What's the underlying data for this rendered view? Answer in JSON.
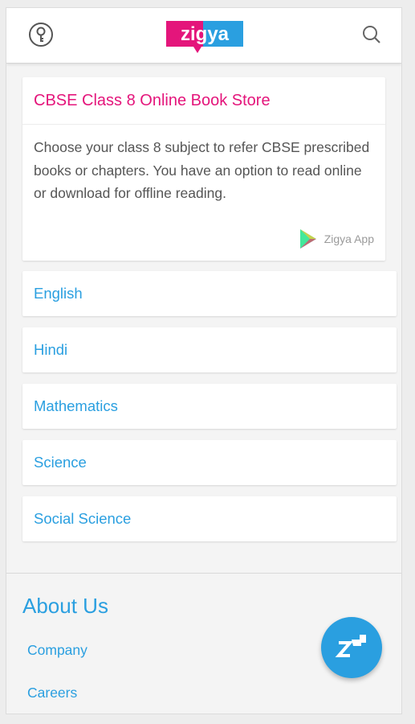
{
  "header": {
    "logo_text": "zigya",
    "icons": [
      "key-icon",
      "search-icon"
    ]
  },
  "intro": {
    "title": "CBSE Class 8 Online Book Store",
    "description": "Choose your class 8 subject to refer CBSE prescribed books or chapters. You have an option to read online or download for offline reading.",
    "app_label": "Zigya App",
    "app_icon": "google-play-icon"
  },
  "subjects": [
    "English",
    "Hindi",
    "Mathematics",
    "Science",
    "Social Science"
  ],
  "footer": {
    "about_title": "About Us",
    "links": [
      "Company",
      "Careers"
    ]
  },
  "fab_icon": "zigya-share-icon",
  "colors": {
    "brand_pink": "#e4157b",
    "brand_blue": "#2a9fe0",
    "text_gray": "#555555",
    "background": "#f4f4f4"
  }
}
